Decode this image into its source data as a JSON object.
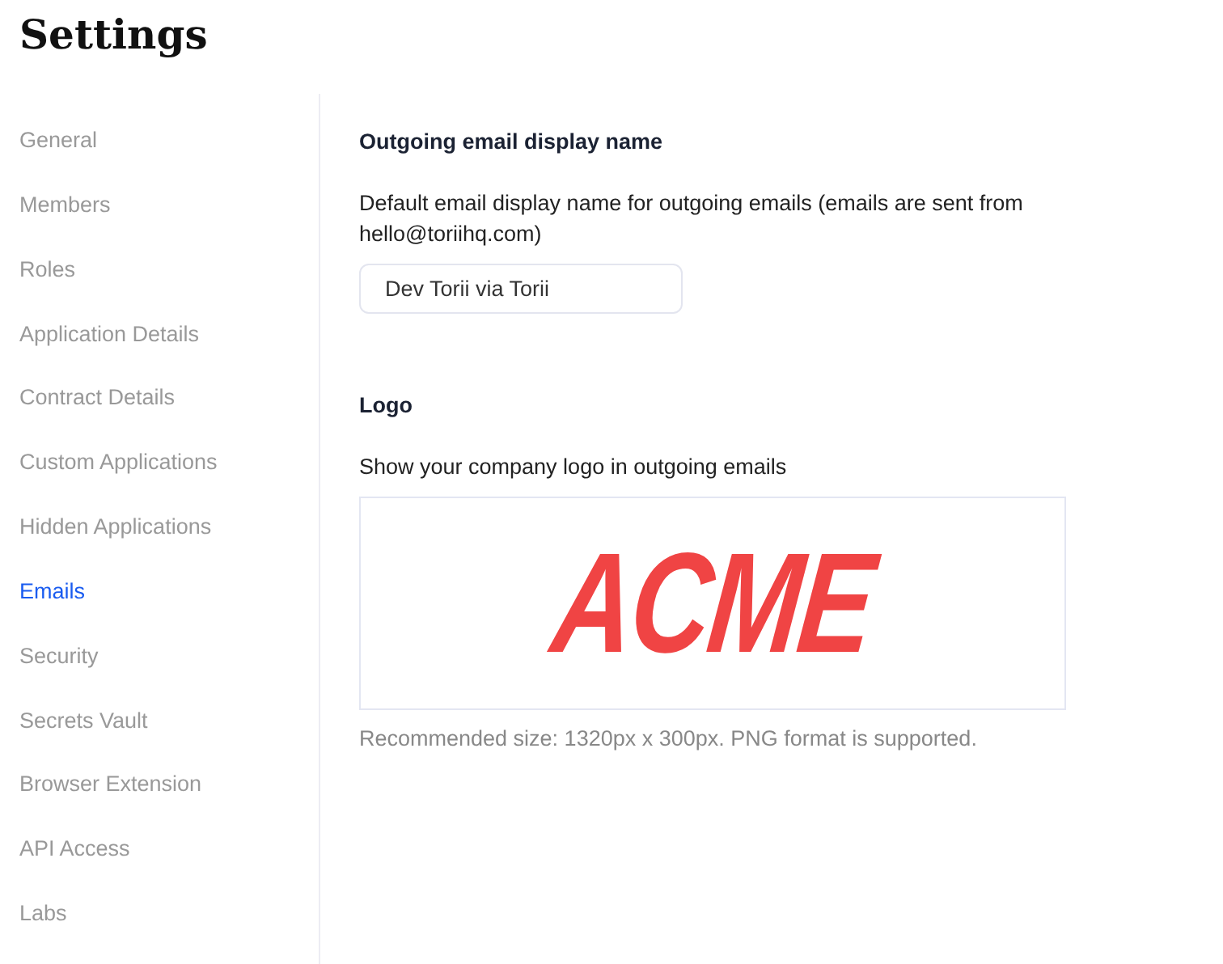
{
  "title": "Settings",
  "sidebar": {
    "items": [
      {
        "label": "General",
        "selected": false
      },
      {
        "label": "Members",
        "selected": false
      },
      {
        "label": "Roles",
        "selected": false
      },
      {
        "label": "Application Details",
        "selected": false
      },
      {
        "label": "Contract Details",
        "selected": false
      },
      {
        "label": "Custom Applications",
        "selected": false
      },
      {
        "label": "Hidden Applications",
        "selected": false
      },
      {
        "label": "Emails",
        "selected": true
      },
      {
        "label": "Security",
        "selected": false
      },
      {
        "label": "Secrets Vault",
        "selected": false
      },
      {
        "label": "Browser Extension",
        "selected": false
      },
      {
        "label": "API Access",
        "selected": false
      },
      {
        "label": "Labs",
        "selected": false
      }
    ]
  },
  "display_name": {
    "heading": "Outgoing email display name",
    "description": "Default email display name for outgoing emails (emails are sent from hello@toriihq.com)",
    "value": "Dev Torii via Torii"
  },
  "logo": {
    "heading": "Logo",
    "description": "Show your company logo in outgoing emails",
    "logo_text": "ACME",
    "hint": "Recommended size: 1320px x 300px. PNG format is supported."
  }
}
